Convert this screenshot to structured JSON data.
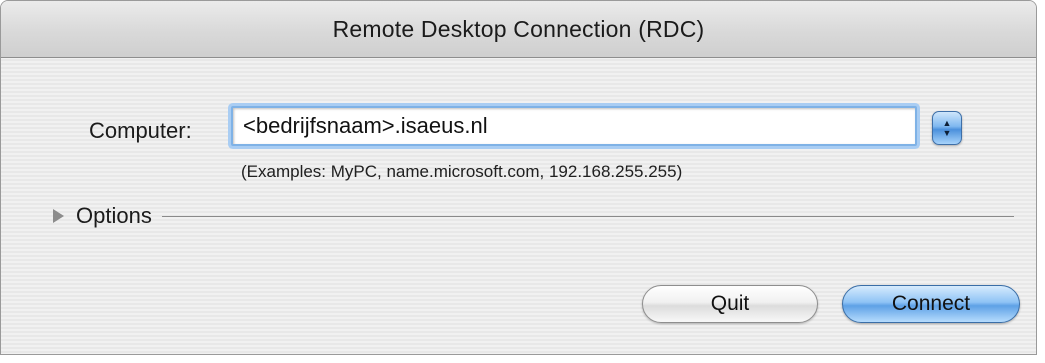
{
  "window": {
    "title": "Remote Desktop Connection (RDC)"
  },
  "form": {
    "computer_label": "Computer:",
    "computer_value": "<bedrijfsnaam>.isaeus.nl",
    "examples": "(Examples: MyPC, name.microsoft.com, 192.168.255.255)",
    "history_icon": "up-down-arrows-icon"
  },
  "options": {
    "label": "Options",
    "icon": "disclosure-triangle-icon",
    "expanded": false
  },
  "buttons": {
    "quit_label": "Quit",
    "connect_label": "Connect"
  },
  "colors": {
    "focus_ring": "#7fb2e6",
    "default_button": "#5ea1e6"
  }
}
